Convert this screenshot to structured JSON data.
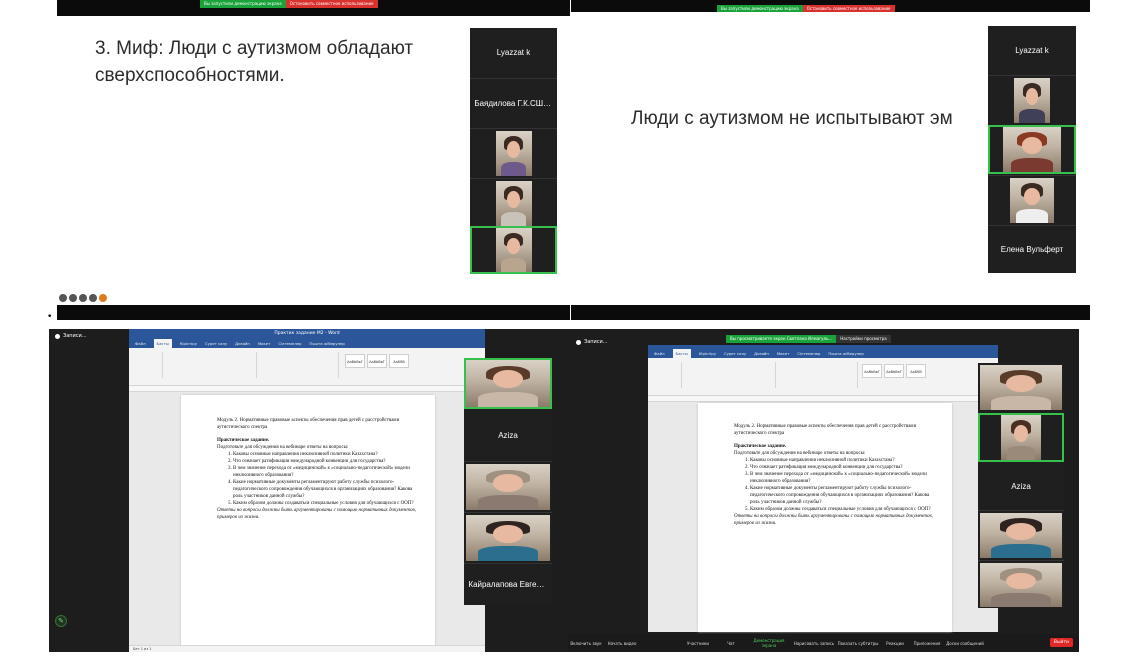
{
  "colors": {
    "zoom_green": "#1aa33a",
    "zoom_red": "#d8322f",
    "active_border": "#37c04b",
    "word_blue": "#2b579a"
  },
  "top_left": {
    "banner": {
      "share": "Вы запустили демонстрацию экрана",
      "stop": "Остановить совместное использование"
    },
    "slide_line1": "3. Миф: Люди с аутизмом обладают",
    "slide_line2": "сверхспособностями.",
    "participants": [
      "Lyazzat k",
      "Баядилова Г.К.СШ7Ак..."
    ]
  },
  "top_right": {
    "banner": {
      "share": "Вы запустили демонстрацию экрана",
      "stop": "Остановить совместное использование"
    },
    "slide_text": "Люди с аутизмом не испытывают эм",
    "participants": [
      "Lyazzat k",
      "Елена Вульферт"
    ]
  },
  "bottom_common": {
    "doc_heading": "Модуль 2. Нормативные правовые аспекты обеспечения прав детей с расстройствами аутистического спектра",
    "practice_title": "Практическое задание.",
    "instructions": "Подготовьте для обсуждения на вебинаре ответы на вопросы:",
    "questions": [
      "Каковы основные направления инклюзивной политики Казахстана?",
      "Что означает ратификация международной конвенции для государства?",
      "В чем значение перехода от «медицинской» к «социально-педагогической» модели инклюзивного образования?",
      "Какие нормативные документы регламентируют работу службы психолого-педагогического сопровождения обучающихся в организациях образования? Какова роль участников данной службы?",
      "Каким образом должны создаваться специальные условия для обучающихся с ООП?"
    ],
    "note": "Ответы на вопросы должны быть аргументированы с помощью нормативных документов, примеров из жизни."
  },
  "bottom_left": {
    "record_label": "Записи...",
    "word_title": "Практик задание М2 - Word",
    "participants": [
      "Aziza",
      "Кайралапова Евгения"
    ]
  },
  "bottom_right": {
    "record_label": "Записи...",
    "banner": {
      "share": "Вы просматриваете экран Светлана Илмагуль...",
      "settings": "Настройки просмотра"
    },
    "participants": [
      "Aziza"
    ],
    "toolbar": [
      "Включить звук",
      "Начать видео",
      "Участники",
      "Чат",
      "Демонстрация экрана",
      "Нарисовать запись",
      "Показать субтитры",
      "Реакции",
      "Приложения",
      "Доски сообщений"
    ],
    "end_label": "Выйти"
  },
  "word_tabs": [
    "Файл",
    "Басты",
    "Кірістіру",
    "Сурет салу",
    "Дизайн",
    "Макет",
    "Сілтемелер",
    "Пошта жіберулер",
    "Рецензиялау",
    "Көрініс",
    "Анықтама"
  ],
  "word_status": "Бет 1 из 1"
}
